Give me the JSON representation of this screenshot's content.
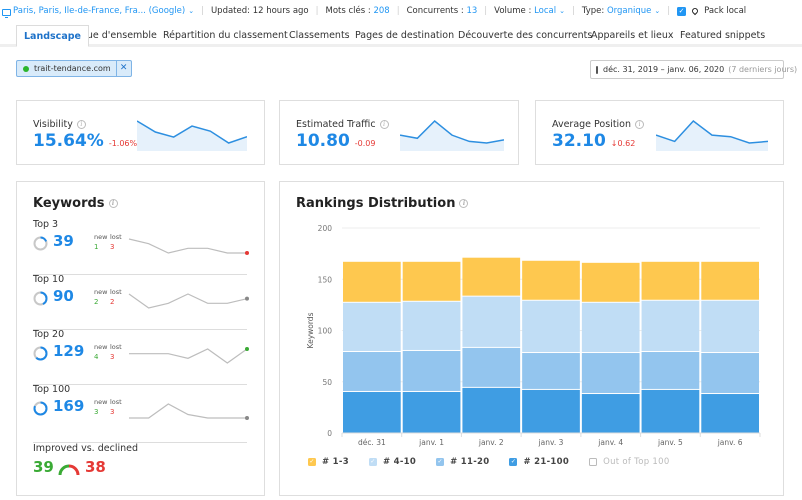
{
  "topbar": {
    "location": "Paris, Paris, Ile-de-France, Fra... (Google)",
    "updated": "Updated: 12 hours ago",
    "keywords_label": "Mots clés : ",
    "keywords_value": "208",
    "competitors_label": "Concurrents : ",
    "competitors_value": "13",
    "volume_label": "Volume : ",
    "volume_value": "Local",
    "type_label": "Type: ",
    "type_value": "Organique",
    "local_pack_label": "Pack local",
    "local_pack_checked": true
  },
  "tabs": [
    {
      "label": "Landscape",
      "active": true
    },
    {
      "label": "Vue d'ensemble"
    },
    {
      "label": "Répartition du classement"
    },
    {
      "label": "Classements"
    },
    {
      "label": "Pages de destination"
    },
    {
      "label": "Découverte des concurrents"
    },
    {
      "label": "Appareils et lieux"
    },
    {
      "label": "Featured snippets"
    }
  ],
  "domain_chip": {
    "label": "trait-tendance.com",
    "status_color": "#2bb52b"
  },
  "date_range": {
    "range": "déc. 31, 2019 – janv. 06, 2020",
    "note": "(7 derniers jours)"
  },
  "metrics": [
    {
      "label": "Visibility",
      "value": "15.64%",
      "delta": "-1.06%",
      "trend": [
        17.5,
        16.2,
        15.6,
        16.9,
        16.3,
        14.9,
        15.64
      ]
    },
    {
      "label": "Estimated Traffic",
      "value": "10.80",
      "delta": "-0.09",
      "trend": [
        11.1,
        10.9,
        12.0,
        11.1,
        10.7,
        10.6,
        10.8
      ]
    },
    {
      "label": "Average Position",
      "value": "32.10",
      "delta": "↓0.62",
      "trend": [
        32.5,
        32.1,
        33.4,
        32.5,
        32.4,
        32.0,
        32.1
      ]
    }
  ],
  "keywords": {
    "title": "Keywords",
    "new_label": "new",
    "lost_label": "lost",
    "rows": [
      {
        "name": "Top 3",
        "value": "39",
        "new": "1",
        "lost": "3",
        "share": 0.19,
        "trend": [
          41,
          40,
          38,
          39,
          39,
          38,
          38
        ],
        "end_color": "#e53935"
      },
      {
        "name": "Top 10",
        "value": "90",
        "new": "2",
        "lost": "2",
        "share": 0.43,
        "trend": [
          89,
          86,
          87,
          89,
          87,
          87,
          88
        ],
        "end_color": "#888888"
      },
      {
        "name": "Top 20",
        "value": "129",
        "new": "4",
        "lost": "3",
        "share": 0.62,
        "trend": [
          128,
          128,
          128,
          127,
          129,
          126,
          129
        ],
        "end_color": "#3aaa35"
      },
      {
        "name": "Top 100",
        "value": "169",
        "new": "3",
        "lost": "3",
        "share": 0.81,
        "trend": [
          168,
          168,
          172,
          169,
          168,
          168,
          168
        ],
        "end_color": "#888888"
      }
    ],
    "improved_title": "Improved vs. declined",
    "improved": "39",
    "declined": "38"
  },
  "rankings": {
    "title": "Rankings Distribution"
  },
  "chart_data": {
    "type": "bar",
    "stacked": true,
    "title": "Rankings Distribution",
    "xlabel": "",
    "ylabel": "Keywords",
    "ylim": [
      0,
      200
    ],
    "yticks": [
      0,
      50,
      100,
      150,
      200
    ],
    "grid": true,
    "legend_position": "bottom-left",
    "categories": [
      "déc. 31",
      "janv. 1",
      "janv. 2",
      "janv. 3",
      "janv. 4",
      "janv. 5",
      "janv. 6"
    ],
    "series": [
      {
        "name": "# 21-100",
        "color": "#3f9de3",
        "values": [
          41,
          41,
          45,
          43,
          39,
          43,
          39
        ],
        "checked": true
      },
      {
        "name": "# 11-20",
        "color": "#93c5ee",
        "values": [
          39,
          40,
          39,
          36,
          40,
          37,
          40
        ],
        "checked": true
      },
      {
        "name": "# 4-10",
        "color": "#c0ddf5",
        "values": [
          48,
          48,
          50,
          51,
          49,
          50,
          51
        ],
        "checked": true
      },
      {
        "name": "# 1-3",
        "color": "#fec84f",
        "values": [
          40,
          39,
          38,
          39,
          39,
          38,
          38
        ],
        "checked": true
      },
      {
        "name": "Out of Top 100",
        "color": "#cccccc",
        "values": [],
        "checked": false
      }
    ]
  }
}
